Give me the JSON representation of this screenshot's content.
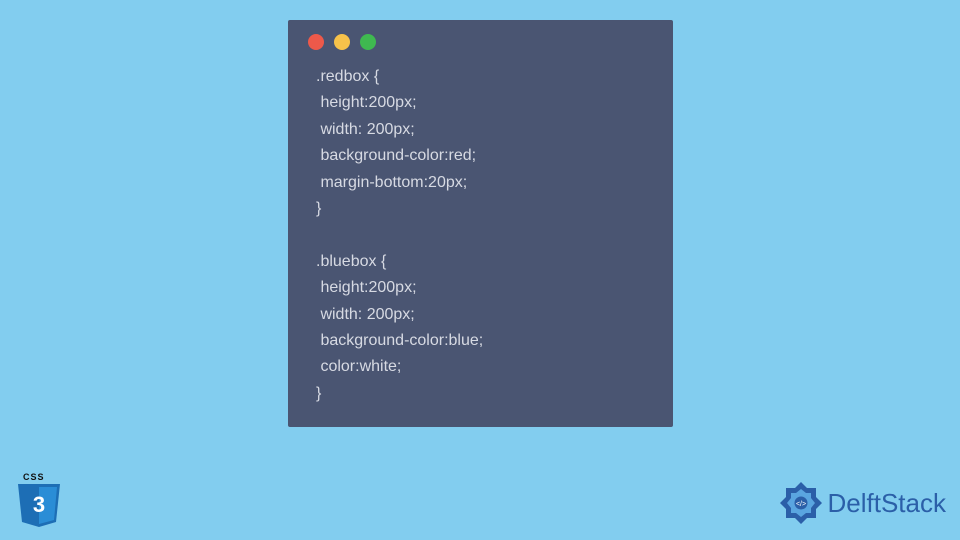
{
  "code_window": {
    "lines": [
      ".redbox {",
      " height:200px;",
      " width: 200px;",
      " background-color:red;",
      " margin-bottom:20px;",
      "}",
      "",
      ".bluebox {",
      " height:200px;",
      " width: 200px;",
      " background-color:blue;",
      " color:white;",
      "}"
    ]
  },
  "css_badge": {
    "label": "CSS",
    "number": "3"
  },
  "brand": {
    "name": "DelftStack"
  },
  "colors": {
    "background": "#82cdef",
    "window": "#4a5572",
    "code_text": "#d7dae3",
    "brand_blue": "#2b5fa8"
  }
}
